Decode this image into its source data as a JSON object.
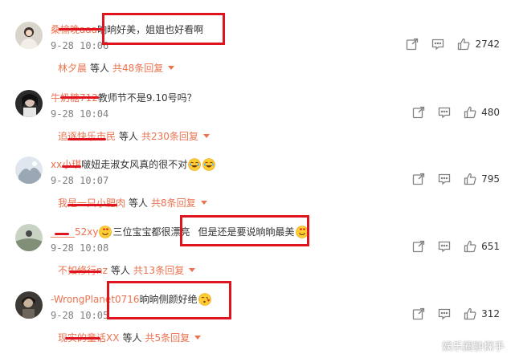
{
  "comments": [
    {
      "username": "桑榆晚aaa",
      "text": "晌晌好美，姐姐也好看啊",
      "time": "9-28 10:06",
      "reply_user": "林夕晨",
      "reply_mid": "等人",
      "reply_count": "共48条回复",
      "likes": "2742"
    },
    {
      "username": "牛奶糖712",
      "text": "教师节不是9.10号吗？",
      "time": "9-28 10:04",
      "reply_user": "追逐快乐市民",
      "reply_mid": "等人",
      "reply_count": "共230条回复",
      "likes": "480"
    },
    {
      "username": "xx小琪",
      "text": "啵妞走淑女风真的很不对",
      "time": "9-28 10:07",
      "reply_user": "我是一只小肥肉",
      "reply_mid": "等人",
      "reply_count": "共8条回复",
      "likes": "795"
    },
    {
      "username": "_____52xy",
      "text": "三位宝宝都很漂亮",
      "text2": "但是还是要说晌晌最美",
      "time": "9-28 10:08",
      "reply_user": "不如修行nz",
      "reply_mid": "等人",
      "reply_count": "共13条回复",
      "likes": "651"
    },
    {
      "username": "-WrongPlanet0716",
      "text": "晌晌侧颜好绝",
      "time": "9-28 10:05",
      "reply_user": "现实的童话XX",
      "reply_mid": "等人",
      "reply_count": "共5条回复",
      "likes": "312"
    }
  ],
  "watermark": "娱乐圈翀探手",
  "colors": {
    "accent": "#eb7350",
    "highlight": "#e0141e",
    "text": "#333333",
    "muted": "#808080"
  },
  "icons": [
    "share-icon",
    "comment-icon",
    "like-icon",
    "laugh-emoji",
    "heart-eyes-emoji",
    "kiss-emoji"
  ]
}
